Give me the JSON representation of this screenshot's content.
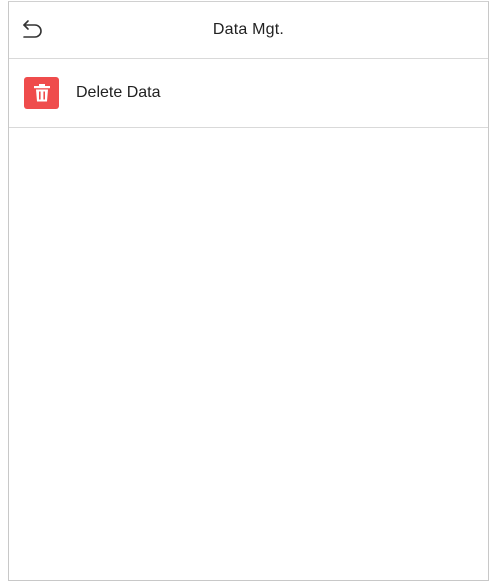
{
  "header": {
    "title": "Data Mgt.",
    "back_icon": "back-arrow-icon"
  },
  "menu": {
    "items": [
      {
        "label": "Delete Data",
        "icon": "trash-icon",
        "icon_color": "#ef4c4c"
      }
    ]
  },
  "colors": {
    "divider": "#d9d9d9",
    "text": "#222222",
    "background": "#ffffff"
  }
}
